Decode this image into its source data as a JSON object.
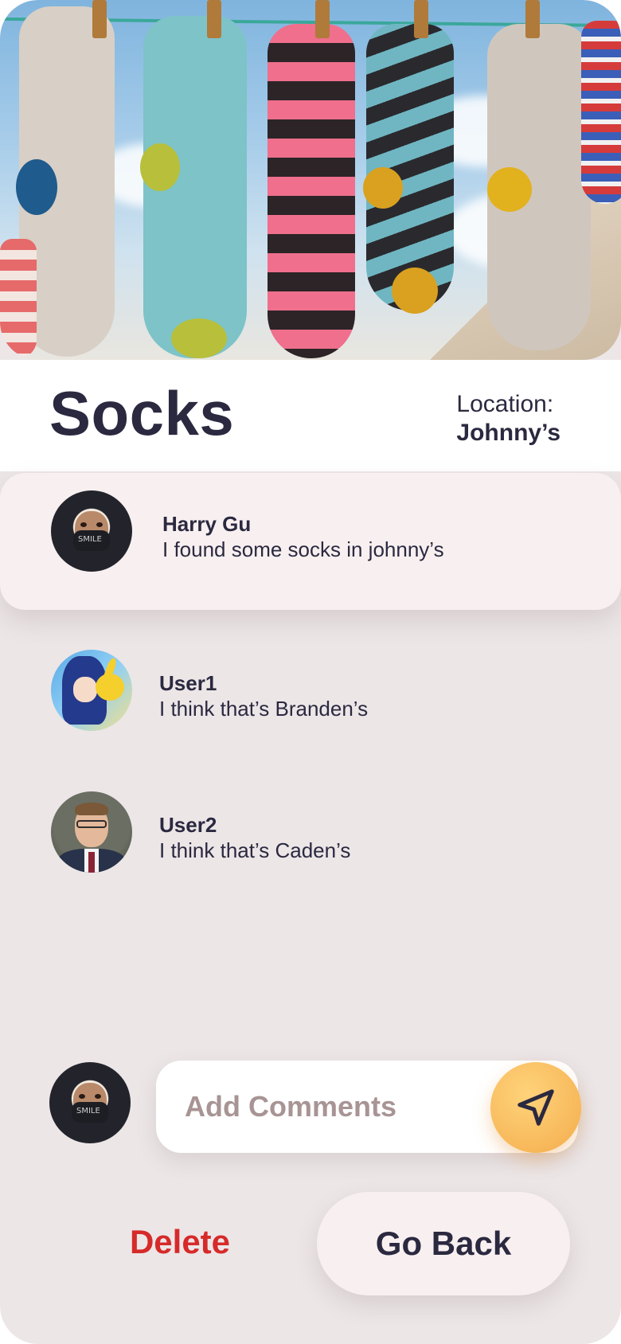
{
  "post": {
    "title": "Socks",
    "location_label": "Location:",
    "location_value": "Johnny’s"
  },
  "comments": [
    {
      "author": "Harry Gu",
      "text": "I found some socks in johnny’s"
    },
    {
      "author": "User1",
      "text": "I think that’s Branden’s"
    },
    {
      "author": "User2",
      "text": "I think that’s Caden’s"
    }
  ],
  "composer": {
    "placeholder": "Add Comments",
    "send_icon": "send-icon"
  },
  "actions": {
    "delete_label": "Delete",
    "go_back_label": "Go Back"
  },
  "colors": {
    "accent_send": "#f7b85a",
    "delete": "#d62a2a",
    "text": "#2b2940",
    "card": "#f8f0f0",
    "background": "#ece6e7"
  }
}
